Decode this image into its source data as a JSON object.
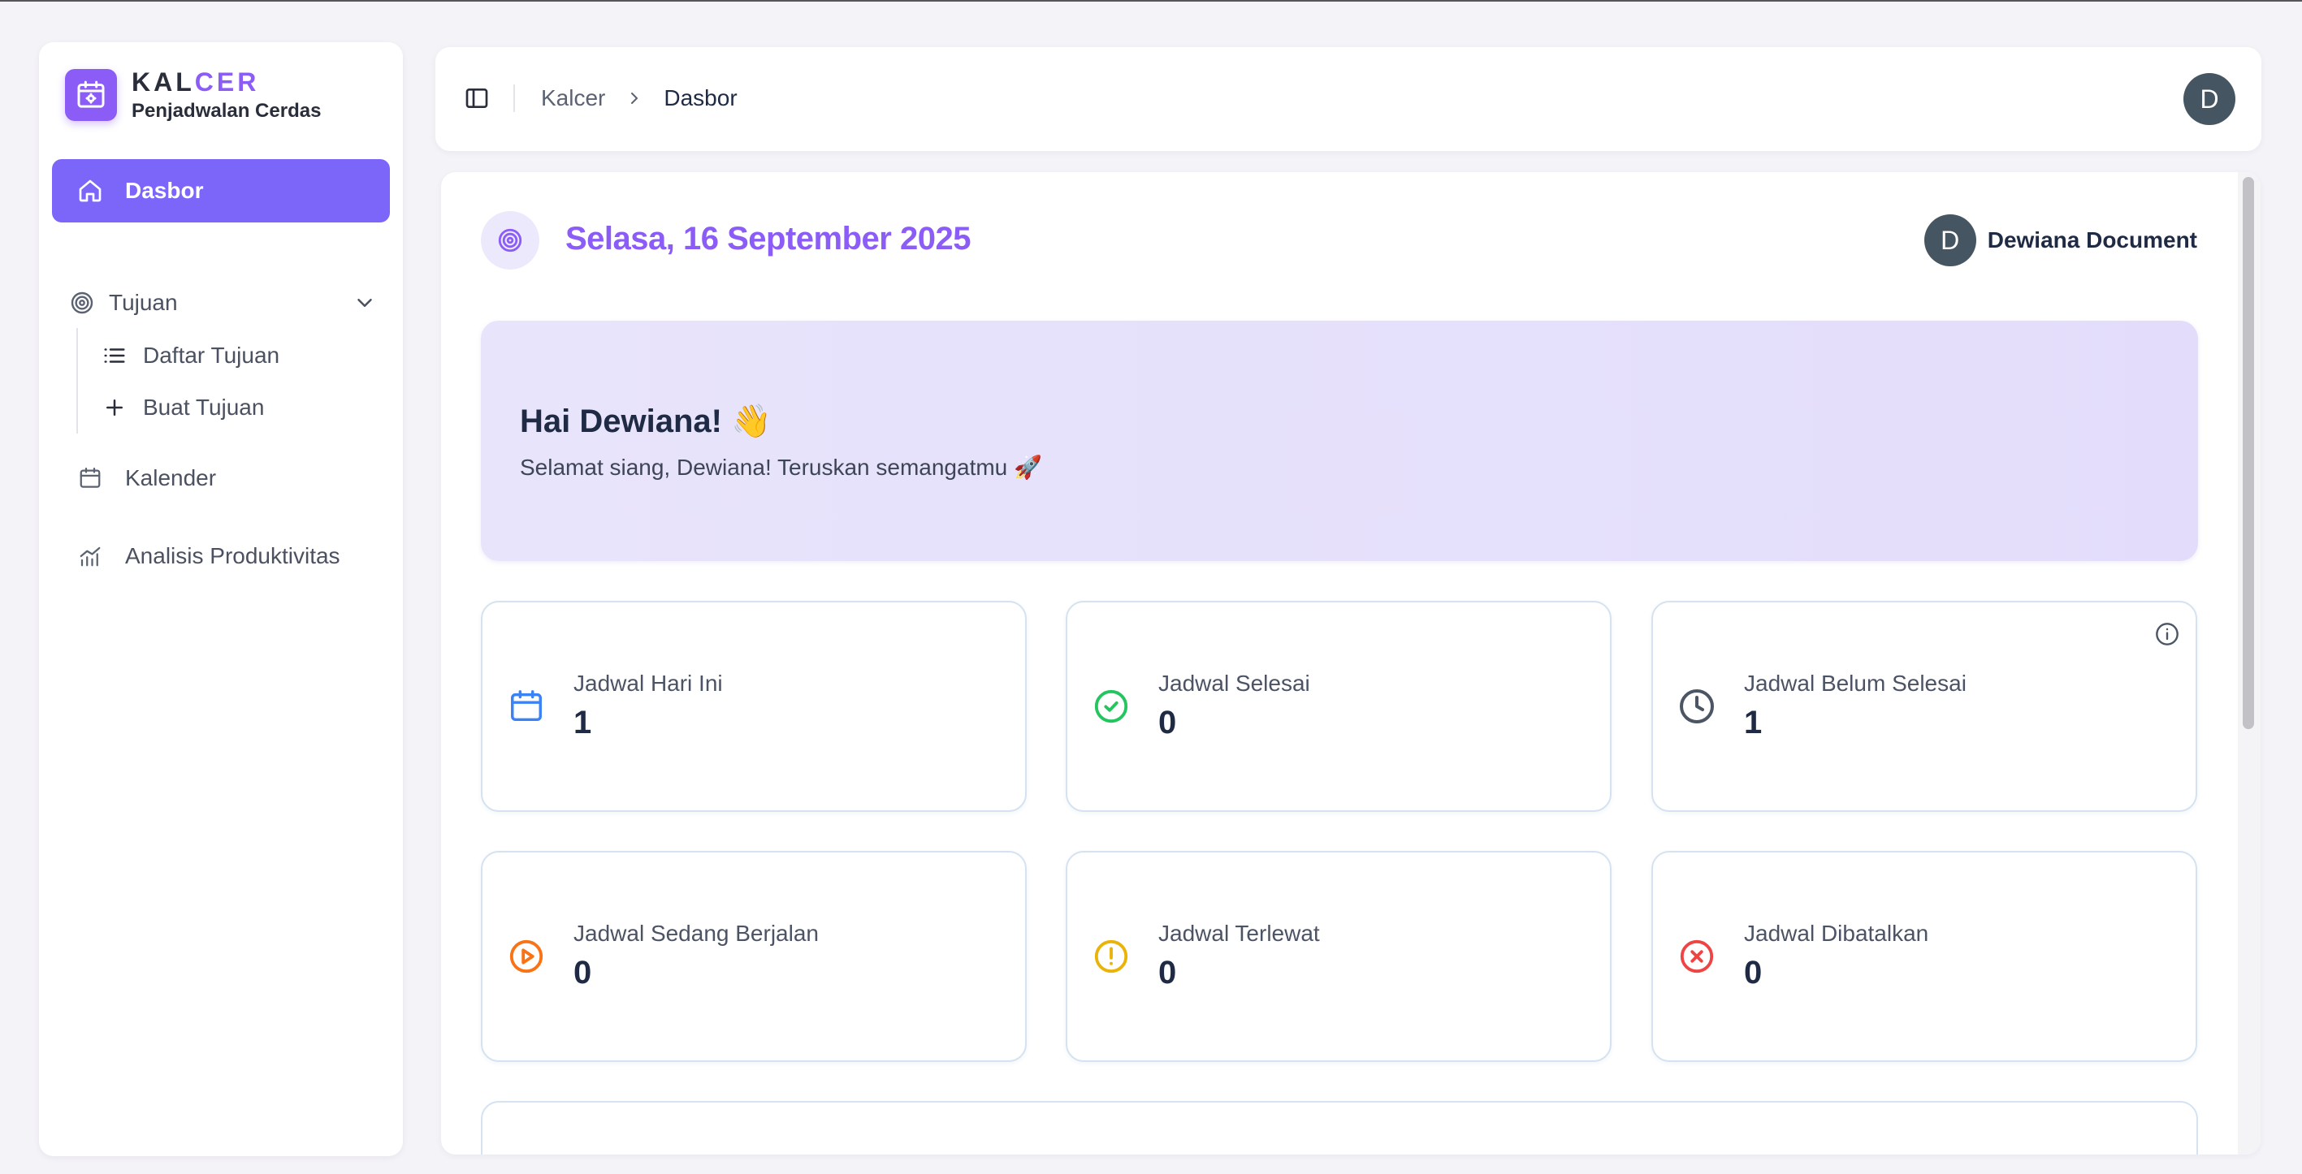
{
  "app": {
    "brand_part1": "KAL",
    "brand_part2": "CER",
    "tagline": "Penjadwalan Cerdas",
    "accent_color": "#8b5cf6"
  },
  "sidebar": {
    "dashboard_label": "Dasbor",
    "goals_label": "Tujuan",
    "goals_items": [
      {
        "label": "Daftar Tujuan",
        "icon": "list-icon"
      },
      {
        "label": "Buat Tujuan",
        "icon": "plus-icon"
      }
    ],
    "calendar_label": "Kalender",
    "analysis_label": "Analisis Produktivitas"
  },
  "header": {
    "breadcrumb": [
      "Kalcer",
      "Dasbor"
    ],
    "avatar_initial": "D"
  },
  "main": {
    "date": "Selasa, 16 September 2025",
    "user_initial": "D",
    "user_name": "Dewiana Document",
    "greeting_title": "Hai Dewiana! 👋",
    "greeting_sub": "Selamat siang, Dewiana! Teruskan semangatmu 🚀"
  },
  "stats": [
    {
      "label": "Jadwal Hari Ini",
      "value": "1",
      "icon": "calendar-icon",
      "color": "#3b82f6"
    },
    {
      "label": "Jadwal Selesai",
      "value": "0",
      "icon": "check-circle-icon",
      "color": "#22c55e"
    },
    {
      "label": "Jadwal Belum Selesai",
      "value": "1",
      "icon": "clock-icon",
      "color": "#4b5563"
    },
    {
      "label": "Jadwal Sedang Berjalan",
      "value": "0",
      "icon": "play-circle-icon",
      "color": "#f97316"
    },
    {
      "label": "Jadwal Terlewat",
      "value": "0",
      "icon": "alert-circle-icon",
      "color": "#eab308"
    },
    {
      "label": "Jadwal Dibatalkan",
      "value": "0",
      "icon": "x-circle-icon",
      "color": "#ef4444"
    }
  ]
}
